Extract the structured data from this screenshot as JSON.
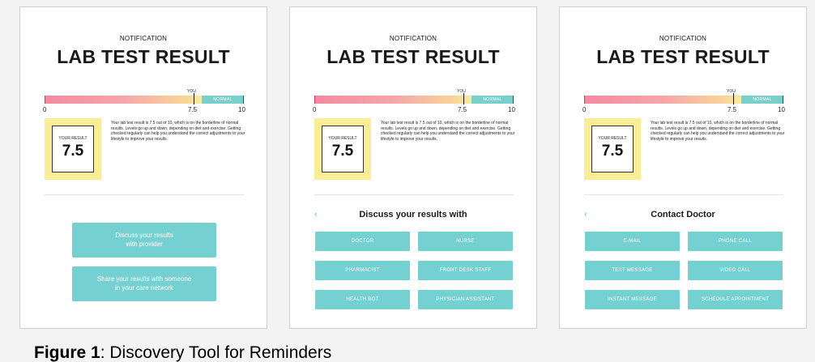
{
  "lab": {
    "kicker": "NOTIFICATION",
    "title": "LAB TEST RESULT",
    "you_label": "YOU",
    "normal_label": "NORMAL",
    "ticks": [
      "0",
      "7.5",
      "10"
    ],
    "result_label": "YOUR RESULT",
    "result_value": "7.5",
    "description": "Your lab test result is 7.5 out of 10, which is on the borderline of normal results. Levels go up and down, depending on diet and exercise. Getting checked regularly can help you understand the correct adjustments to your lifestyle to improve your results."
  },
  "screen1": {
    "buttons": [
      {
        "label": "Discuss your results\nwith provider"
      },
      {
        "label": "Share your results with someone\nin your care network"
      }
    ]
  },
  "screen2": {
    "back_icon": "‹",
    "heading": "Discuss your results with",
    "options": [
      "DOCTOR",
      "NURSE",
      "PHARMACIST",
      "FRONT DESK STAFF",
      "HEALTH BOT",
      "PHYSICIAN ASSISTANT"
    ]
  },
  "screen3": {
    "back_icon": "‹",
    "heading": "Contact Doctor",
    "options": [
      "E-MAIL",
      "PHONE CALL",
      "TEXT MESSAGE",
      "VIDEO CALL",
      "INSTANT MESSAGE",
      "SCHEDULE APPOINTMENT"
    ]
  },
  "caption": {
    "label": "Figure 1",
    "text": ": Discovery Tool for Reminders"
  },
  "colors": {
    "accent_teal": "#75d1d1",
    "result_yellow": "#f9ee97",
    "bar_pink": "#f38aa0"
  }
}
